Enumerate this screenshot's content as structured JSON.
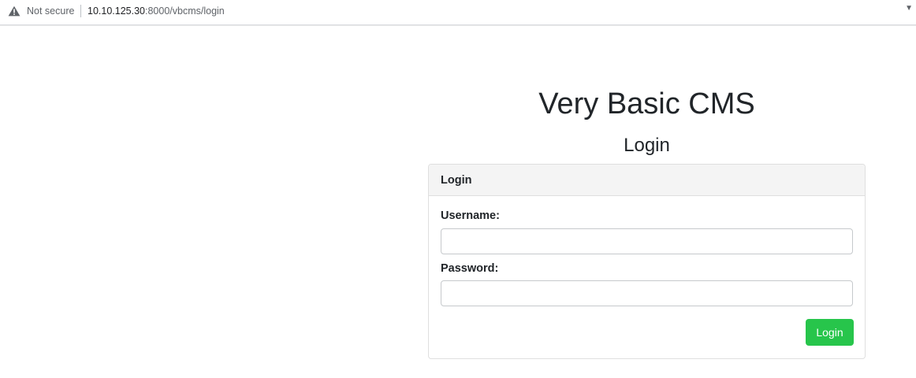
{
  "browser": {
    "security_text": "Not secure",
    "url_host": "10.10.125.30",
    "url_path": ":8000/vbcms/login"
  },
  "page": {
    "site_title": "Very Basic CMS",
    "subtitle": "Login"
  },
  "login_card": {
    "header": "Login",
    "username_label": "Username:",
    "username_value": "",
    "password_label": "Password:",
    "password_value": "",
    "submit_label": "Login"
  },
  "colors": {
    "button_bg": "#27c54b",
    "card_header_bg": "#f4f4f4"
  },
  "icons": {
    "security": "warning-triangle-icon",
    "menu": "caret-down-icon"
  }
}
